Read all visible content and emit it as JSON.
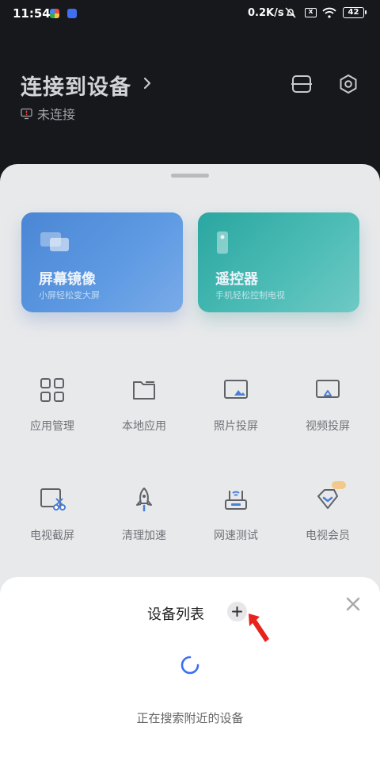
{
  "status_bar": {
    "time": "11:54",
    "network_speed": "0.2K/s",
    "battery": "42",
    "sim_icon_text": "x"
  },
  "header": {
    "title": "连接到设备",
    "connection_status": "未连接"
  },
  "feature_cards": [
    {
      "title": "屏幕镜像",
      "subtitle": "小屏轻松变大屏"
    },
    {
      "title": "遥控器",
      "subtitle": "手机轻松控制电视"
    }
  ],
  "grid_items": [
    {
      "label": "应用管理",
      "icon": "apps-grid-icon"
    },
    {
      "label": "本地应用",
      "icon": "folder-icon"
    },
    {
      "label": "照片投屏",
      "icon": "photo-cast-icon"
    },
    {
      "label": "视频投屏",
      "icon": "video-cast-icon"
    },
    {
      "label": "电视截屏",
      "icon": "tv-screenshot-icon"
    },
    {
      "label": "清理加速",
      "icon": "rocket-icon"
    },
    {
      "label": "网速测试",
      "icon": "router-icon"
    },
    {
      "label": "电视会员",
      "icon": "vip-diamond-icon"
    }
  ],
  "device_dialog": {
    "title": "设备列表",
    "status": "正在搜索附近的设备"
  },
  "colors": {
    "accent_blue": "#3b6ef5",
    "annotation_red": "#e8231d",
    "mirror_card": "#4a86d4",
    "remote_card": "#2aa6a0"
  }
}
